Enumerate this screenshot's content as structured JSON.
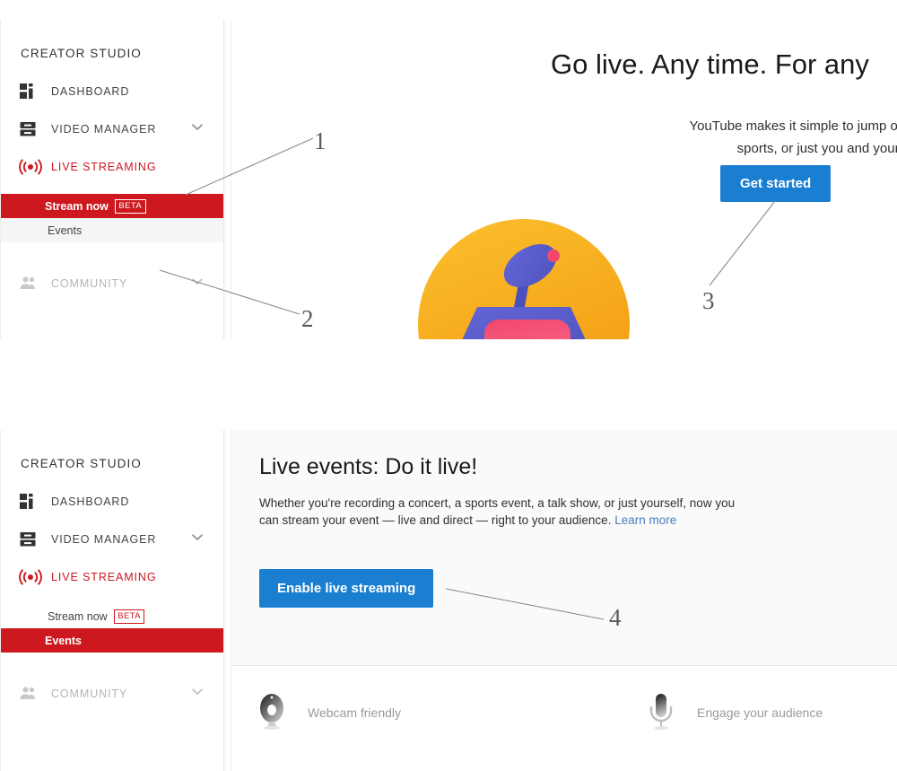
{
  "sidebar": {
    "title": "CREATOR STUDIO",
    "items": [
      {
        "label": "DASHBOARD",
        "icon": "dashboard-icon",
        "state": "normal",
        "chevron": false
      },
      {
        "label": "VIDEO MANAGER",
        "icon": "video-manager-icon",
        "state": "normal",
        "chevron": true
      },
      {
        "label": "LIVE STREAMING",
        "icon": "live-streaming-icon",
        "state": "active",
        "chevron": false
      },
      {
        "label": "COMMUNITY",
        "icon": "community-icon",
        "state": "muted",
        "chevron": true
      }
    ],
    "sub_items_top": [
      {
        "label": "Stream now",
        "badge": "BETA",
        "selected": true
      },
      {
        "label": "Events",
        "badge": "",
        "selected": false
      }
    ],
    "sub_items_bottom": [
      {
        "label": "Stream now",
        "badge": "BETA",
        "selected": false
      },
      {
        "label": "Events",
        "badge": "",
        "selected": true
      }
    ]
  },
  "hero": {
    "title": "Go live. Any time. For any",
    "subtitle": "YouTube makes it simple to jump online with game p\nsports, or just you and your thoughts",
    "button_label": "Get started"
  },
  "live_events": {
    "title": "Live events: Do it live!",
    "body": "Whether you're recording a concert, a sports event, a talk show, or just yourself, now you can stream your event — live and direct — right to your audience. ",
    "link_label": "Learn more",
    "button_label": "Enable live streaming",
    "features": [
      {
        "label": "Webcam friendly",
        "icon": "webcam-icon"
      },
      {
        "label": "Engage your audience",
        "icon": "microphone-icon"
      }
    ]
  },
  "annotations": [
    {
      "number": "1",
      "target": "live-streaming-nav-item"
    },
    {
      "number": "2",
      "target": "events-sub-item"
    },
    {
      "number": "3",
      "target": "get-started-button"
    },
    {
      "number": "4",
      "target": "enable-live-streaming-button"
    }
  ],
  "colors": {
    "brand_red": "#cc181e",
    "accent_blue": "#1b7fd1",
    "link_blue": "#4a7ebb",
    "illustration_orange": "#f5b02e",
    "illustration_purple": "#5b5fc7",
    "illustration_pink": "#f2476b"
  }
}
